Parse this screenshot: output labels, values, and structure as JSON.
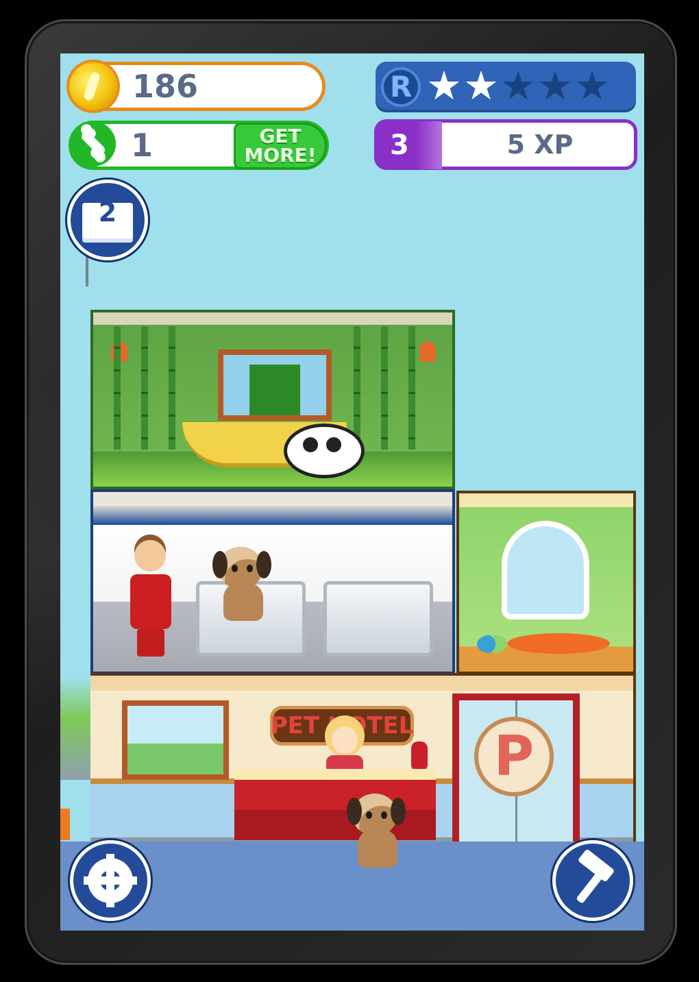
{
  "hud": {
    "coins": "186",
    "rating_letter": "R",
    "stars_filled": 2,
    "stars_total": 5,
    "bones": "1",
    "get_more_label": "GET\nMORE!",
    "level": "3",
    "xp": "5 XP",
    "book_count": "2"
  },
  "lobby": {
    "sign_text": "PET HOTEL",
    "door_letter": "P"
  },
  "colors": {
    "sky": "#9fe0ec",
    "coin_border": "#e98a1c",
    "bone_border": "#21b827",
    "rating_blue": "#2f64b8",
    "xp_purple": "#8a2fc8",
    "button_blue": "#234b9a"
  },
  "icons": {
    "coin": "coin-icon",
    "bone": "bone-icon",
    "book": "book-icon",
    "settings": "gear-icon",
    "build": "hammer-icon"
  }
}
